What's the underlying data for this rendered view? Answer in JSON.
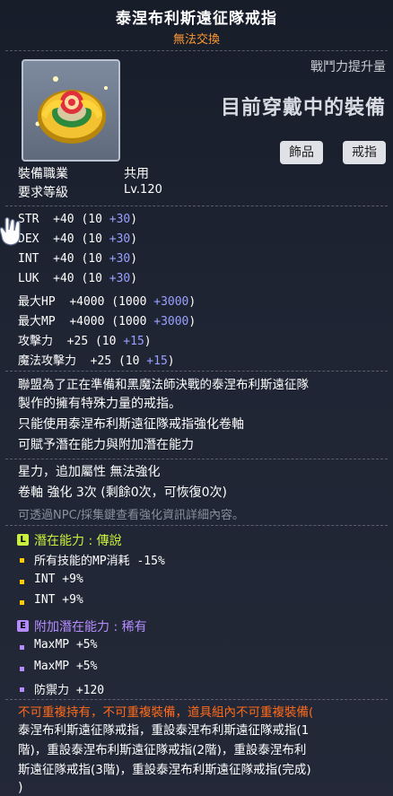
{
  "item": {
    "name": "泰涅布利斯遠征隊戒指",
    "trade_status": "無法交換",
    "power_label": "戰鬥力提升量",
    "wearing_label": "目前穿戴中的裝備",
    "tags": [
      "飾品",
      "戒指"
    ],
    "icon": "ring-item-icon"
  },
  "requirements": [
    {
      "label": "裝備職業",
      "value": "共用"
    },
    {
      "label": "要求等級",
      "value": "Lv.120"
    }
  ],
  "stats": [
    {
      "name": "STR",
      "total": "+40",
      "base": "(10 ",
      "bonus": "+30",
      "close": ")"
    },
    {
      "name": "DEX",
      "total": "+40",
      "base": "(10 ",
      "bonus": "+30",
      "close": ")"
    },
    {
      "name": "INT",
      "total": "+40",
      "base": "(10 ",
      "bonus": "+30",
      "close": ")"
    },
    {
      "name": "LUK",
      "total": "+40",
      "base": "(10 ",
      "bonus": "+30",
      "close": ")"
    },
    {
      "name": "最大HP",
      "total": "+4000",
      "base": "(1000 ",
      "bonus": "+3000",
      "close": ")"
    },
    {
      "name": "最大MP",
      "total": "+4000",
      "base": "(1000 ",
      "bonus": "+3000",
      "close": ")"
    },
    {
      "name": "攻擊力",
      "total": "+25",
      "base": "(10 ",
      "bonus": "+15",
      "close": ")"
    },
    {
      "name": "魔法攻擊力",
      "total": "+25",
      "base": "(10 ",
      "bonus": "+15",
      "close": ")"
    }
  ],
  "description": [
    "聯盟為了正在準備和黑魔法師決戰的泰涅布利斯遠征隊",
    "製作的擁有特殊力量的戒指。",
    "只能使用泰涅布利斯遠征隊戒指強化卷軸",
    "可賦予潛在能力與附加潛在能力"
  ],
  "enhance": [
    "星力，追加屬性 無法強化",
    "卷軸 強化 3次 (剩餘0次，可恢復0次)"
  ],
  "hint": "可透過NPC/採集鍵查看強化資訊詳細內容。",
  "potential": {
    "badge": "L",
    "title": "潛在能力 : 傳說",
    "color": "#c8f03c",
    "lines": [
      "所有技能的MP消耗 -15%",
      "INT +9%",
      "INT +9%"
    ]
  },
  "additional": {
    "badge": "E",
    "title": "附加潛在能力 : 稀有",
    "color": "#b58cff",
    "lines": [
      "MaxMP +5%",
      "MaxMP +5%",
      "防禦力 +120"
    ]
  },
  "set": {
    "warning": "不可重複持有，不可重複裝備，道具組內不可重複裝備(",
    "lines": [
      "泰涅布利斯遠征隊戒指，重設泰涅布利斯遠征隊戒指(1",
      "階)，重設泰涅布利斯遠征隊戒指(2階)，重設泰涅布利",
      "斯遠征隊戒指(3階)，重設泰涅布利斯遠征隊戒指(完成)",
      ")"
    ]
  }
}
